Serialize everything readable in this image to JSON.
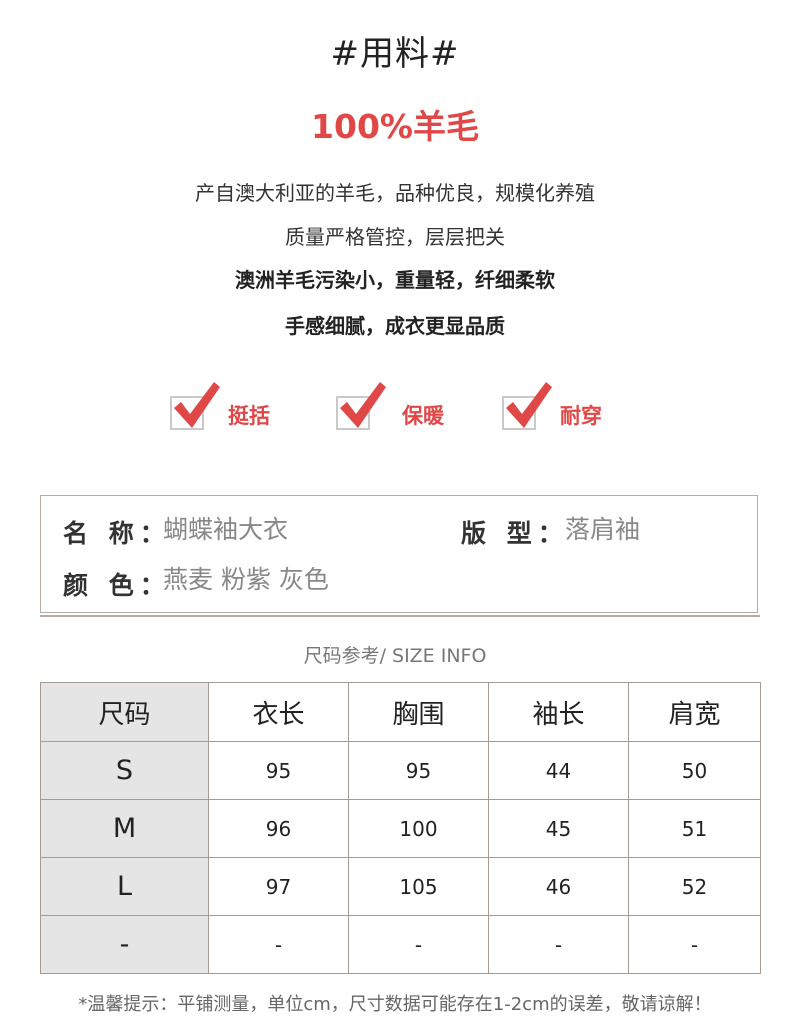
{
  "section_title": "#用料#",
  "material_headline": "100%羊毛",
  "description_lines": [
    "产自澳大利亚的羊毛，品种优良，规模化养殖",
    "质量严格管控，层层把关",
    "澳洲羊毛污染小，重量轻，纤细柔软",
    "手感细腻，成衣更显品质"
  ],
  "features": [
    "挺括",
    "保暖",
    "耐穿"
  ],
  "product_info": {
    "name_label": "名 称：",
    "name_value": "蝴蝶袖大衣",
    "style_label": "版 型：",
    "style_value": "落肩袖",
    "color_label": "颜 色：",
    "color_value": "燕麦 粉紫 灰色"
  },
  "size_caption": "尺码参考/ SIZE INFO",
  "size_table": {
    "headers": [
      "尺码",
      "衣长",
      "胸围",
      "袖长",
      "肩宽"
    ],
    "rows": [
      [
        "S",
        "95",
        "95",
        "44",
        "50"
      ],
      [
        "M",
        "96",
        "100",
        "45",
        "51"
      ],
      [
        "L",
        "97",
        "105",
        "46",
        "52"
      ],
      [
        "-",
        "-",
        "-",
        "-",
        "-"
      ]
    ]
  },
  "footnote": "*温馨提示：平铺测量，单位cm，尺寸数据可能存在1-2cm的误差，敬请谅解！",
  "colors": {
    "accent_red": "#e04848",
    "border_brown": "#b9aaa2",
    "header_gray": "#e5e5e5"
  }
}
